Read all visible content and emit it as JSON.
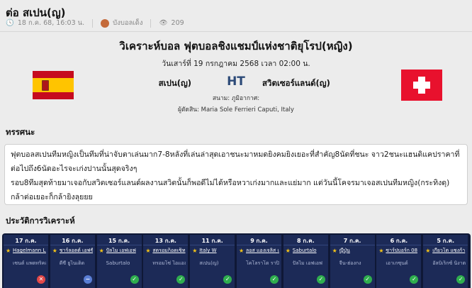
{
  "page": {
    "title": "ต่อ สเปน(ญ)",
    "published": "18 ก.ค. 68, 16:03 น.",
    "author": "บังบอลเด็ง",
    "views": "209"
  },
  "match": {
    "heading": "วิเคราะห์บอล ฟุตบอลชิงแชมป์แห่งชาติยุโรป(หญิง)",
    "datetime": "วันเสาร์ที่ 19 กรกฎาคม 2568 เวลา 02:00 น.",
    "home_team": "สเปน(ญ)",
    "away_team": "สวิตเซอร์แลนด์(ญ)",
    "score": "HT",
    "stadium": "สนาม: ภูมิอากาศ:",
    "referee": "ผู้ตัดสิน: Maria Sole Ferrieri Caputi, Italy"
  },
  "opinion": {
    "heading": "ทรรศนะ",
    "text1": "ฟุตบอลสเปนทีมหญิงเป็นทีมที่น่าจับตาเล่นมาก7-8หลังที่เล่นล่าสุดเอาชนะมาหมดยิงคมยิงเยอะที่สำคัญ8นัดที่ชนะ จาว2ชนะแฮนดิแคปราคาที่ต่อไปถึง6นัดอะไรจะเก่งปานนั้นสุดจริงๆ",
    "text2": "รอบ8ทีมสุดท้ายมาเจอกับสวิตเซอร์แลนด์ผลงานสวิตนั้นก็พอดีไม่ได้หรือหวาเก่งมากและแย่มาก แต่วันนี้โคจรมาเจอสเปนทีมหญิง(กระทิงดุ) กล้าต่อเยอะก็กล้ายิงลุยยย"
  },
  "history": {
    "heading": "ประวัติการวิเคราะห์",
    "items": [
      {
        "date": "17 ก.ค.",
        "pick": "Hagelmann Litauen",
        "other": "เซนต์ แพตทริคส์ แอธเลติก",
        "result": "loss",
        "result_icon": "✕"
      },
      {
        "date": "16 ก.ค.",
        "pick": "ชาร์ลอตต์ เอฟซี",
        "other": "ดีซี ยูไนเต็ด",
        "result": "draw",
        "result_icon": "−"
      },
      {
        "date": "15 ก.ค.",
        "pick": "ปัลไม เอฟเอฟ",
        "other": "Saburtalo",
        "result": "win",
        "result_icon": "✓"
      },
      {
        "date": "13 ก.ค.",
        "pick": "สตรอมก็อดเซ็ท",
        "other": "ทรอมโซ่ ไอแอล",
        "result": "win",
        "result_icon": "✓"
      },
      {
        "date": "11 ก.ค.",
        "pick": "Italy W",
        "other": "สเปน(ญ)",
        "result": "win",
        "result_icon": "✓"
      },
      {
        "date": "9 ก.ค.",
        "pick": "ลอส แองเจลิส เอฟซี",
        "other": "โคโลราโด ราปิดส์",
        "result": "win",
        "result_icon": "✓"
      },
      {
        "date": "8 ก.ค.",
        "pick": "Saburtalo",
        "other": "ปัลไม เอฟเอฟ",
        "result": "win",
        "result_icon": "✓"
      },
      {
        "date": "7 ก.ค.",
        "pick": "ญี่ปุ่น",
        "other": "จีน-ฮ่องกง",
        "result": "win",
        "result_icon": "✓"
      },
      {
        "date": "6 ก.ค.",
        "pick": "ซาร์ปบอร์ก 08",
        "other": "เอาเกซุนด์",
        "result": "win",
        "result_icon": "✓"
      },
      {
        "date": "5 ก.ค.",
        "pick": "เกียวโต แซงก้า",
        "other": "อัลบิเร็กซ์ นิงาตะ",
        "result": "win",
        "result_icon": "✓"
      }
    ]
  }
}
